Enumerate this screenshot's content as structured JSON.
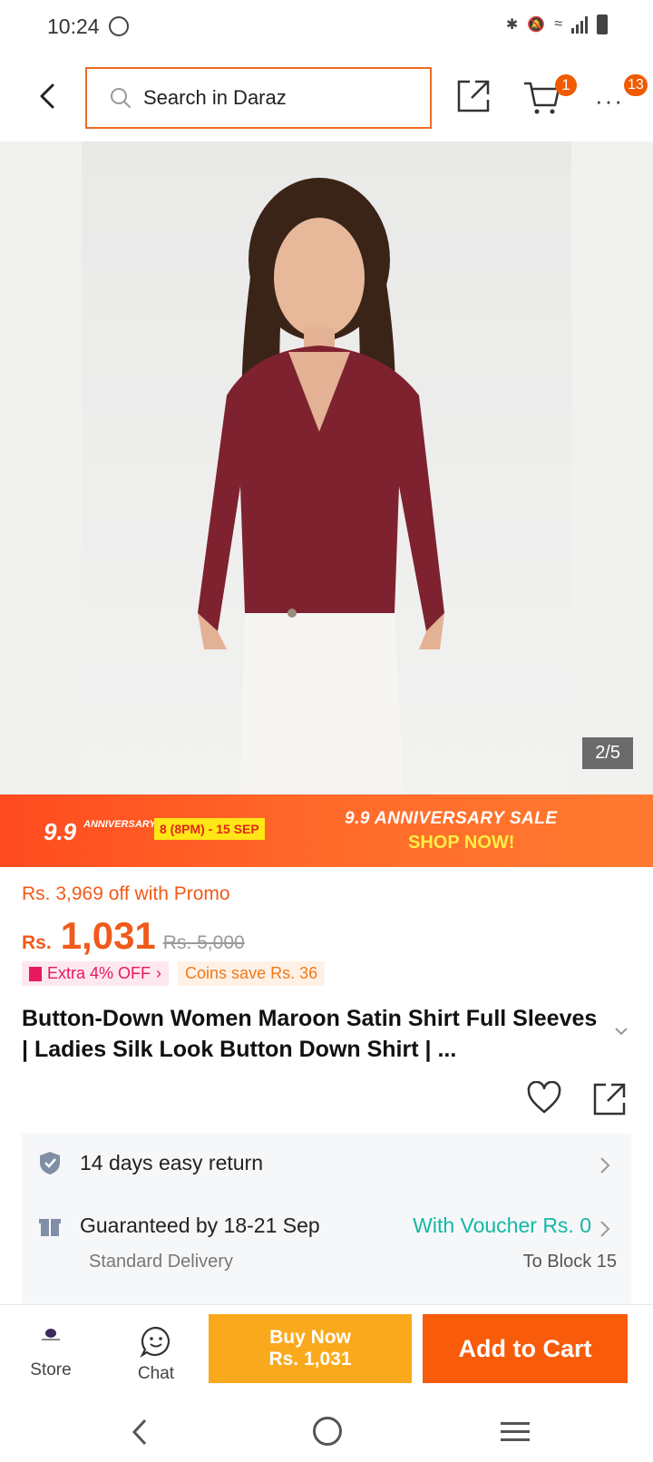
{
  "status_bar": {
    "time": "10:24"
  },
  "header": {
    "search_placeholder": "Search in Daraz",
    "cart_count": "1",
    "more_count": "13"
  },
  "gallery": {
    "counter": "2/5"
  },
  "promo_banner": {
    "logo": "9.9",
    "logo_sub": "ANNIVERSARY SALE",
    "dates": "8 (8PM) - 15 SEP",
    "title": "9.9 ANNIVERSARY SALE",
    "cta": "SHOP NOW!"
  },
  "price": {
    "promo_off": "Rs. 3,969 off with Promo",
    "currency": "Rs.",
    "current": "1,031",
    "original": "Rs. 5,000",
    "extra_tag": "Extra 4% OFF",
    "coins_tag": "Coins save Rs. 36"
  },
  "product": {
    "title": "Button-Down Women Maroon Satin Shirt Full Sleeves | Ladies Silk Look Button Down Shirt | ..."
  },
  "info": {
    "return_text": "14 days easy return",
    "delivery_text": "Guaranteed by 18-21 Sep",
    "voucher_text": "With Voucher Rs. 0",
    "delivery_type": "Standard Delivery",
    "location": "To Block 15"
  },
  "bottom_bar": {
    "store_label": "Store",
    "chat_label": "Chat",
    "buy_now_line1": "Buy Now",
    "buy_now_line2": "Rs. 1,031",
    "add_to_cart": "Add to Cart"
  },
  "colors": {
    "accent": "#f85b09",
    "buy_now": "#fba91c",
    "voucher": "#13b8a6",
    "price": "#f05a1a"
  }
}
